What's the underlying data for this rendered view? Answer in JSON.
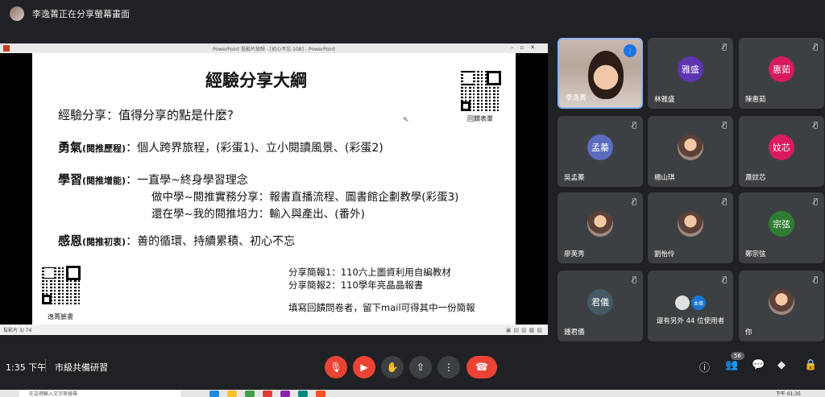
{
  "top": {
    "sharing_text": "李逸菁正在分享螢幕畫面"
  },
  "presentation": {
    "window_title": "PowerPoint 投影片放映 - [初心不忘 108] - PowerPoint",
    "status_text": "投影片 3/ 74",
    "slide": {
      "title": "經驗分享大綱",
      "question": "經驗分享：值得分享的點是什麼?",
      "courage_head": "勇氣",
      "courage_tag": "(閱推歷程)",
      "courage_text": "：個人跨界旅程，(彩蛋1)、立小閱讀風景、(彩蛋2)",
      "learn_head": "學習",
      "learn_tag": "(閱推增能)",
      "learn_line1": "：一直學~終身學習理念",
      "learn_line2": "做中學~閱推實務分享：報書直播流程、圖書館企劃教學(彩蛋3)",
      "learn_line3": "還在學~我的閱推培力：輸入與產出、(番外)",
      "thanks_head": "感恩",
      "thanks_tag": "(閱推初衷)",
      "thanks_text": "：善的循環、持續累積、初心不忘",
      "share1": "分享簡報1：110六上圖資利用自編教材",
      "share2": "分享簡報2：110學年亮晶晶報書",
      "share_note": "填寫回饋問卷者，留下mail可得其中一份簡報",
      "qr_top_label": "回饋表單",
      "qr_bottom_label": "逸菁臉書"
    }
  },
  "participants": [
    {
      "name": "李逸菁",
      "initials": "",
      "color": "",
      "type": "video"
    },
    {
      "name": "林雅盛",
      "initials": "雅盛",
      "color": "#5e35b1",
      "type": "initials"
    },
    {
      "name": "陳惠茹",
      "initials": "惠茹",
      "color": "#d81b60",
      "type": "initials"
    },
    {
      "name": "吳孟蓁",
      "initials": "孟蓁",
      "color": "#5c6bc0",
      "type": "initials"
    },
    {
      "name": "楊山琪",
      "initials": "",
      "color": "",
      "type": "photo"
    },
    {
      "name": "蕭妏芯",
      "initials": "妏芯",
      "color": "#d81b60",
      "type": "initials"
    },
    {
      "name": "廖英秀",
      "initials": "",
      "color": "",
      "type": "photo"
    },
    {
      "name": "劉怡伶",
      "initials": "",
      "color": "",
      "type": "photo"
    },
    {
      "name": "鄭宗弦",
      "initials": "宗弦",
      "color": "#2e7d32",
      "type": "initials"
    },
    {
      "name": "鍾君儀",
      "initials": "君儀",
      "color": "#455a64",
      "type": "initials"
    },
    {
      "name": "還有另外 44 位使用者",
      "initials": "本偉",
      "color": "#1976d2",
      "type": "others"
    },
    {
      "name": "你",
      "initials": "",
      "color": "",
      "type": "photo"
    }
  ],
  "bottom": {
    "time": "1:35 下午",
    "meeting_name": "市級共備研習",
    "people_count": "56",
    "end_icon": "phone-hangup-icon"
  },
  "taskbar": {
    "search_text": "在這裡輸入文字來搜尋",
    "clock": "下午 01:35"
  }
}
